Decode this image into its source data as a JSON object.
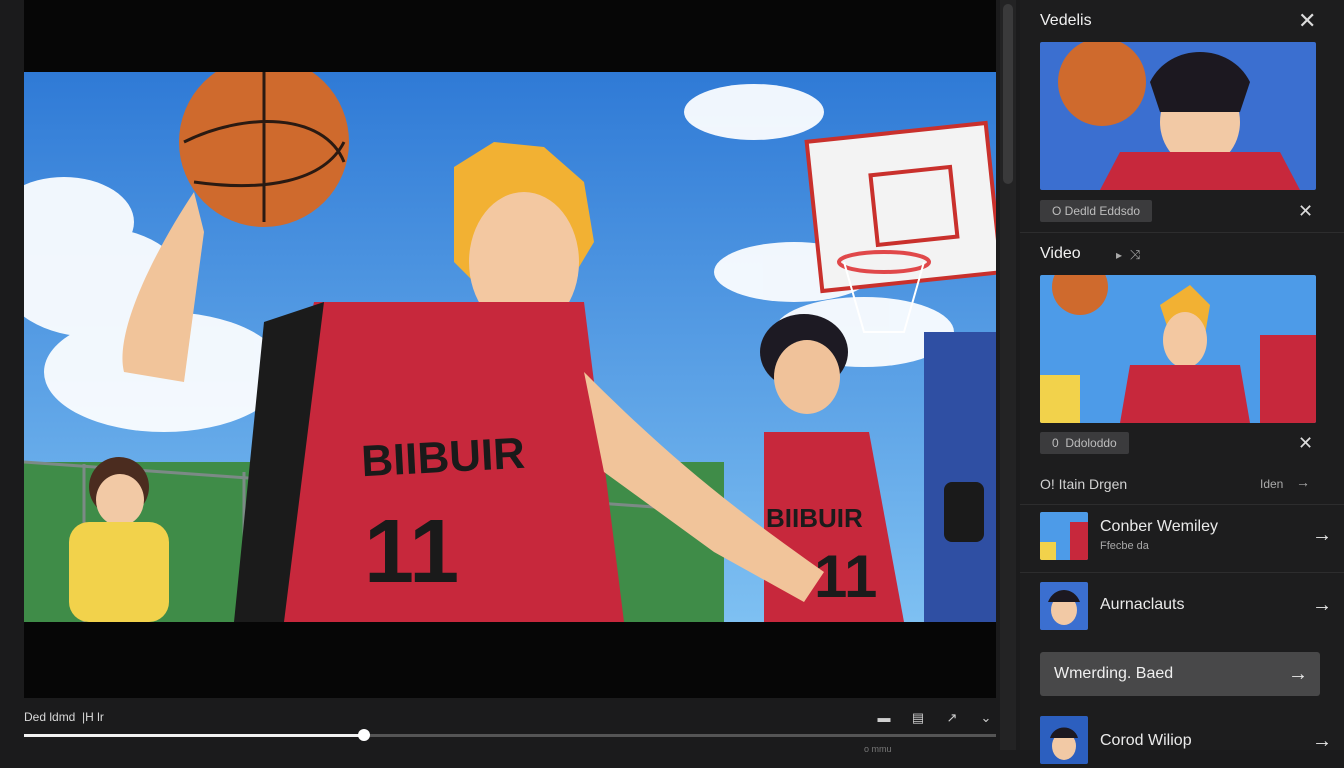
{
  "player": {
    "time_label": "Ded ldmd",
    "time_sep": "|H lr",
    "progress": 0.35,
    "bottom_tiny": "o mmu"
  },
  "controls": {
    "icons": [
      "chapters-icon",
      "subtitles-icon",
      "share-icon",
      "expand-icon"
    ]
  },
  "panel": {
    "section1_title": "Vedelis",
    "chip1": "O Dedld Eddsdo",
    "section2_title": "Video",
    "chip2": "0",
    "chip2_text": "Ddoloddo",
    "list_header": "O! Itain Drgen",
    "list_header_right": "Iden",
    "items": [
      {
        "title": "Conber Wemiley",
        "sub": "Ffecbe da"
      },
      {
        "title": "Aurnaclauts",
        "sub": ""
      },
      {
        "title": "Wmerding. Baed",
        "sub": ""
      },
      {
        "title": "Corod Wiliop",
        "sub": ""
      }
    ]
  },
  "colors": {
    "jersey": "#c7283c",
    "sky": "#3f8fe0",
    "panel": "#1d1d1e"
  }
}
